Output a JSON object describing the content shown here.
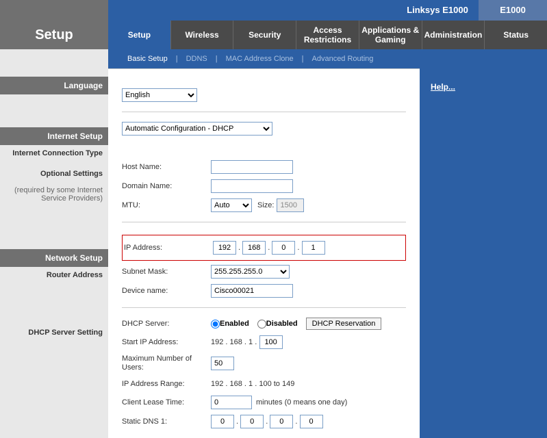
{
  "brand": "Linksys E1000",
  "model": "E1000",
  "pageTitle": "Setup",
  "tabs": [
    "Setup",
    "Wireless",
    "Security",
    "Access Restrictions",
    "Applications & Gaming",
    "Administration",
    "Status"
  ],
  "subtabs": {
    "basic": "Basic Setup",
    "ddns": "DDNS",
    "mac": "MAC Address Clone",
    "routing": "Advanced Routing"
  },
  "helpLink": "Help...",
  "sections": {
    "language": "Language",
    "internetSetup": "Internet Setup",
    "connType": "Internet Connection Type",
    "optional1": "Optional Settings",
    "optional2": "(required by some Internet Service Providers)",
    "networkSetup": "Network Setup",
    "routerAddr": "Router Address",
    "dhcpSetting": "DHCP Server Setting"
  },
  "language": {
    "value": "English"
  },
  "connection": {
    "value": "Automatic Configuration - DHCP"
  },
  "labels": {
    "hostName": "Host Name:",
    "domainName": "Domain Name:",
    "mtu": "MTU:",
    "size": "Size:",
    "ipAddress": "IP Address:",
    "subnet": "Subnet Mask:",
    "deviceName": "Device name:",
    "dhcpServer": "DHCP Server:",
    "enabled": "Enabled",
    "disabled": "Disabled",
    "dhcpReserve": "DHCP Reservation",
    "startIp": "Start IP  Address:",
    "maxUsers": "Maximum Number of Users:",
    "ipRange": "IP Address Range:",
    "leaseTime": "Client Lease Time:",
    "leaseUnit": "minutes (0 means one day)",
    "dns1": "Static DNS 1:"
  },
  "values": {
    "hostName": "",
    "domainName": "",
    "mtu": "Auto",
    "mtuSize": "1500",
    "ip": [
      "192",
      "168",
      "0",
      "1"
    ],
    "subnet": "255.255.255.0",
    "deviceName": "Cisco00021",
    "dhcpEnabled": true,
    "startIpPrefix": "192 . 168 . 1 .",
    "startIp": "100",
    "maxUsers": "50",
    "ipRange": "192 . 168 . 1 . 100 to 149",
    "leaseTime": "0",
    "dns1": [
      "0",
      "0",
      "0",
      "0"
    ]
  }
}
